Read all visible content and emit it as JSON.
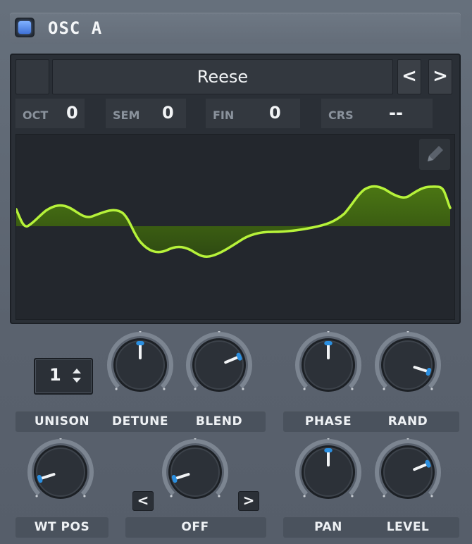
{
  "header": {
    "title": "OSC A",
    "power_on": true
  },
  "wavetable": {
    "name": "Reese",
    "prev_label": "<",
    "next_label": ">"
  },
  "params": [
    {
      "label": "OCT",
      "value": "0"
    },
    {
      "label": "SEM",
      "value": "0"
    },
    {
      "label": "FIN",
      "value": "0"
    },
    {
      "label": "CRS",
      "value": "--"
    }
  ],
  "unison": {
    "value": "1",
    "label": "UNISON"
  },
  "knobs": [
    {
      "name": "detune",
      "label": "DETUNE",
      "value": 0.5
    },
    {
      "name": "blend",
      "label": "BLEND",
      "value": 0.75
    },
    {
      "name": "phase",
      "label": "PHASE",
      "value": 0.5
    },
    {
      "name": "rand",
      "label": "RAND",
      "value": 0.9
    },
    {
      "name": "wt-pos",
      "label": "WT POS",
      "value": 0.1
    },
    {
      "name": "warp",
      "label": "OFF",
      "value": 0.1
    },
    {
      "name": "pan",
      "label": "PAN",
      "value": 0.5
    },
    {
      "name": "level",
      "label": "LEVEL",
      "value": 0.75
    }
  ],
  "warp": {
    "prev_label": "<",
    "next_label": ">"
  },
  "colors": {
    "wave": "#b6f23a",
    "knob_accent": "#2b8fe0"
  }
}
